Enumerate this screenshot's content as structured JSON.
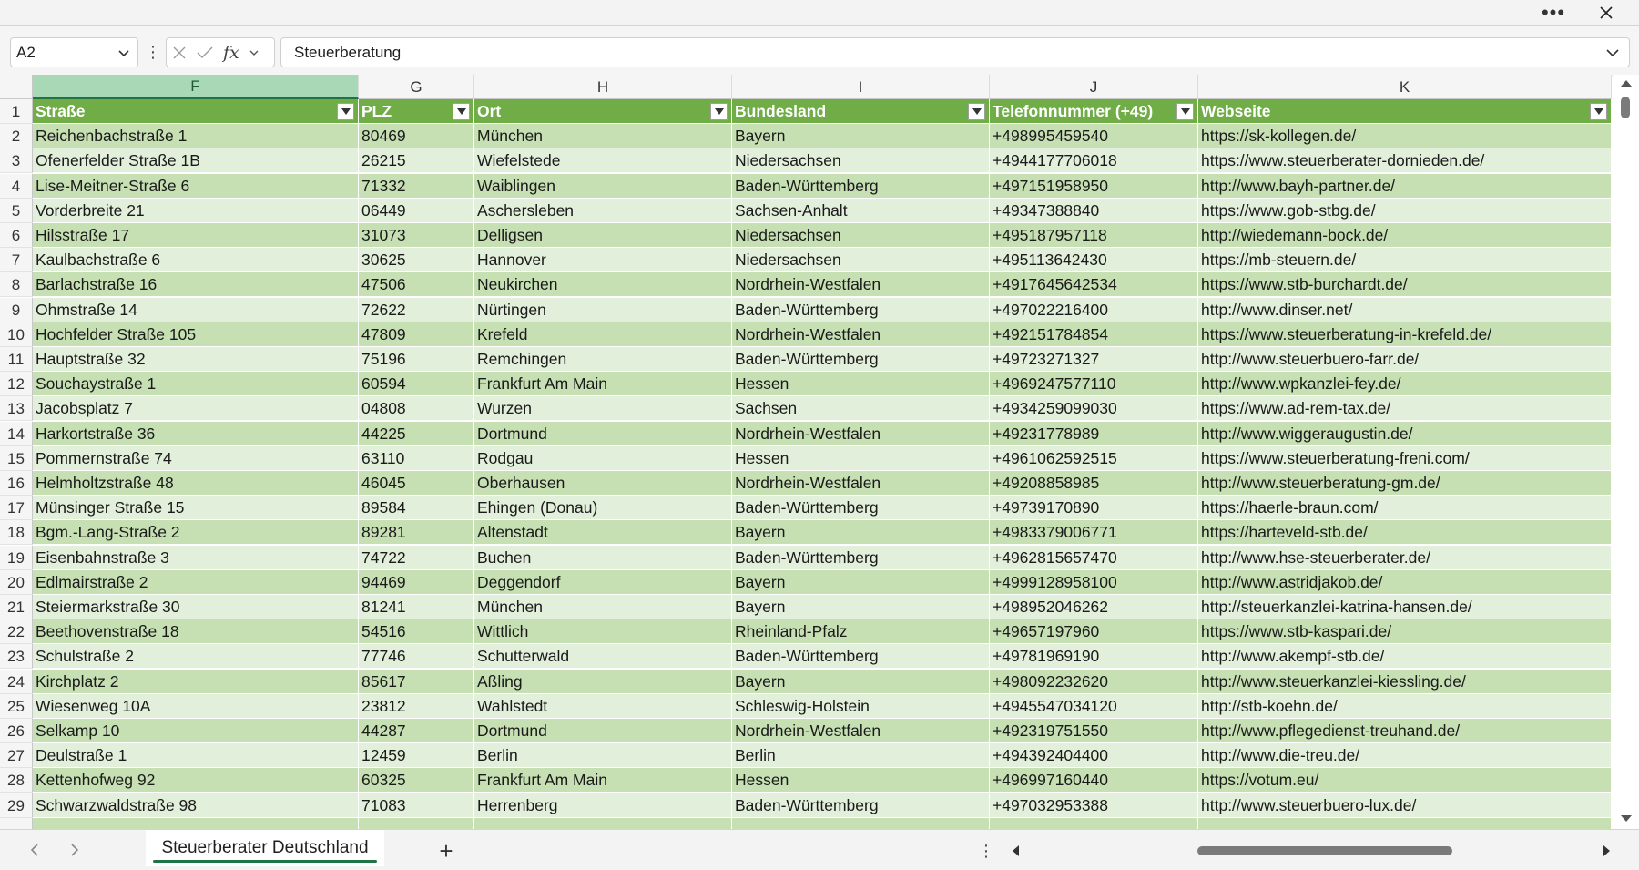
{
  "window": {
    "more_label": "•••"
  },
  "formula_bar": {
    "name_box": "A2",
    "fx_label": "fx",
    "content": "Steuerberatung"
  },
  "columns": [
    {
      "letter": "F",
      "header": "Straße",
      "selected": true
    },
    {
      "letter": "G",
      "header": "PLZ"
    },
    {
      "letter": "H",
      "header": "Ort"
    },
    {
      "letter": "I",
      "header": "Bundesland"
    },
    {
      "letter": "J",
      "header": "Telefonnummer (+49)"
    },
    {
      "letter": "K",
      "header": "Webseite"
    }
  ],
  "rows": [
    {
      "n": "2",
      "cells": [
        "Reichenbachstraße 1",
        "80469",
        "München",
        "Bayern",
        "+498995459540",
        "https://sk-kollegen.de/"
      ]
    },
    {
      "n": "3",
      "cells": [
        "Ofenerfelder Straße 1B",
        "26215",
        "Wiefelstede",
        "Niedersachsen",
        "+4944177706018",
        "https://www.steuerberater-dornieden.de/"
      ]
    },
    {
      "n": "4",
      "cells": [
        "Lise-Meitner-Straße 6",
        "71332",
        "Waiblingen",
        "Baden-Württemberg",
        "+497151958950",
        "http://www.bayh-partner.de/"
      ]
    },
    {
      "n": "5",
      "cells": [
        "Vorderbreite 21",
        "06449",
        "Aschersleben",
        "Sachsen-Anhalt",
        "+49347388840",
        "https://www.gob-stbg.de/"
      ]
    },
    {
      "n": "6",
      "cells": [
        "Hilsstraße 17",
        "31073",
        "Delligsen",
        "Niedersachsen",
        "+495187957118",
        "http://wiedemann-bock.de/"
      ]
    },
    {
      "n": "7",
      "cells": [
        "Kaulbachstraße 6",
        "30625",
        "Hannover",
        "Niedersachsen",
        "+495113642430",
        "https://mb-steuern.de/"
      ]
    },
    {
      "n": "8",
      "cells": [
        "Barlachstraße 16",
        "47506",
        "Neukirchen",
        "Nordrhein-Westfalen",
        "+4917645642534",
        "https://www.stb-burchardt.de/"
      ]
    },
    {
      "n": "9",
      "cells": [
        "Ohmstraße 14",
        "72622",
        "Nürtingen",
        "Baden-Württemberg",
        "+497022216400",
        "http://www.dinser.net/"
      ]
    },
    {
      "n": "10",
      "cells": [
        "Hochfelder Straße 105",
        "47809",
        "Krefeld",
        "Nordrhein-Westfalen",
        "+492151784854",
        "https://www.steuerberatung-in-krefeld.de/"
      ]
    },
    {
      "n": "11",
      "cells": [
        "Hauptstraße 32",
        "75196",
        "Remchingen",
        "Baden-Württemberg",
        "+49723271327",
        "http://www.steuerbuero-farr.de/"
      ]
    },
    {
      "n": "12",
      "cells": [
        "Souchaystraße 1",
        "60594",
        "Frankfurt Am Main",
        "Hessen",
        "+4969247577110",
        "http://www.wpkanzlei-fey.de/"
      ]
    },
    {
      "n": "13",
      "cells": [
        "Jacobsplatz 7",
        "04808",
        "Wurzen",
        "Sachsen",
        "+4934259099030",
        "https://www.ad-rem-tax.de/"
      ]
    },
    {
      "n": "14",
      "cells": [
        "Harkortstraße 36",
        "44225",
        "Dortmund",
        "Nordrhein-Westfalen",
        "+49231778989",
        "http://www.wiggeraugustin.de/"
      ]
    },
    {
      "n": "15",
      "cells": [
        "Pommernstraße 74",
        "63110",
        "Rodgau",
        "Hessen",
        "+4961062592515",
        "https://www.steuerberatung-freni.com/"
      ]
    },
    {
      "n": "16",
      "cells": [
        "Helmholtzstraße 48",
        "46045",
        "Oberhausen",
        "Nordrhein-Westfalen",
        "+49208858985",
        "http://www.steuerberatung-gm.de/"
      ]
    },
    {
      "n": "17",
      "cells": [
        "Münsinger Straße 15",
        "89584",
        "Ehingen (Donau)",
        "Baden-Württemberg",
        "+49739170890",
        "https://haerle-braun.com/"
      ]
    },
    {
      "n": "18",
      "cells": [
        "Bgm.-Lang-Straße 2",
        "89281",
        "Altenstadt",
        "Bayern",
        "+4983379006771",
        "https://harteveld-stb.de/"
      ]
    },
    {
      "n": "19",
      "cells": [
        "Eisenbahnstraße 3",
        "74722",
        "Buchen",
        "Baden-Württemberg",
        "+4962815657470",
        "http://www.hse-steuerberater.de/"
      ]
    },
    {
      "n": "20",
      "cells": [
        "Edlmairstraße 2",
        "94469",
        "Deggendorf",
        "Bayern",
        "+4999128958100",
        "http://www.astridjakob.de/"
      ]
    },
    {
      "n": "21",
      "cells": [
        "Steiermarkstraße 30",
        "81241",
        "München",
        "Bayern",
        "+498952046262",
        "http://steuerkanzlei-katrina-hansen.de/"
      ]
    },
    {
      "n": "22",
      "cells": [
        "Beethovenstraße 18",
        "54516",
        "Wittlich",
        "Rheinland-Pfalz",
        "+49657197960",
        "https://www.stb-kaspari.de/"
      ]
    },
    {
      "n": "23",
      "cells": [
        "Schulstraße 2",
        "77746",
        "Schutterwald",
        "Baden-Württemberg",
        "+49781969190",
        "http://www.akempf-stb.de/"
      ]
    },
    {
      "n": "24",
      "cells": [
        "Kirchplatz 2",
        "85617",
        "Aßling",
        "Bayern",
        "+498092232620",
        "http://www.steuerkanzlei-kiessling.de/"
      ]
    },
    {
      "n": "25",
      "cells": [
        "Wiesenweg 10A",
        "23812",
        "Wahlstedt",
        "Schleswig-Holstein",
        "+4945547034120",
        "http://stb-koehn.de/"
      ]
    },
    {
      "n": "26",
      "cells": [
        "Selkamp 10",
        "44287",
        "Dortmund",
        "Nordrhein-Westfalen",
        "+492319751550",
        "http://www.pflegedienst-treuhand.de/"
      ]
    },
    {
      "n": "27",
      "cells": [
        "Deulstraße 1",
        "12459",
        "Berlin",
        "Berlin",
        "+494392404400",
        "http://www.die-treu.de/"
      ]
    },
    {
      "n": "28",
      "cells": [
        "Kettenhofweg 92",
        "60325",
        "Frankfurt Am Main",
        "Hessen",
        "+496997160440",
        "https://votum.eu/"
      ]
    },
    {
      "n": "29",
      "cells": [
        "Schwarzwaldstraße 98",
        "71083",
        "Herrenberg",
        "Baden-Württemberg",
        "+497032953388",
        "http://www.steuerbuero-lux.de/"
      ]
    }
  ],
  "sheet": {
    "tab_label": "Steuerberater Deutschland",
    "add_label": "+"
  },
  "colors": {
    "header_green": "#70ad47",
    "band_dark": "#c6e0b4",
    "band_light": "#e2efda",
    "accent": "#217346"
  }
}
